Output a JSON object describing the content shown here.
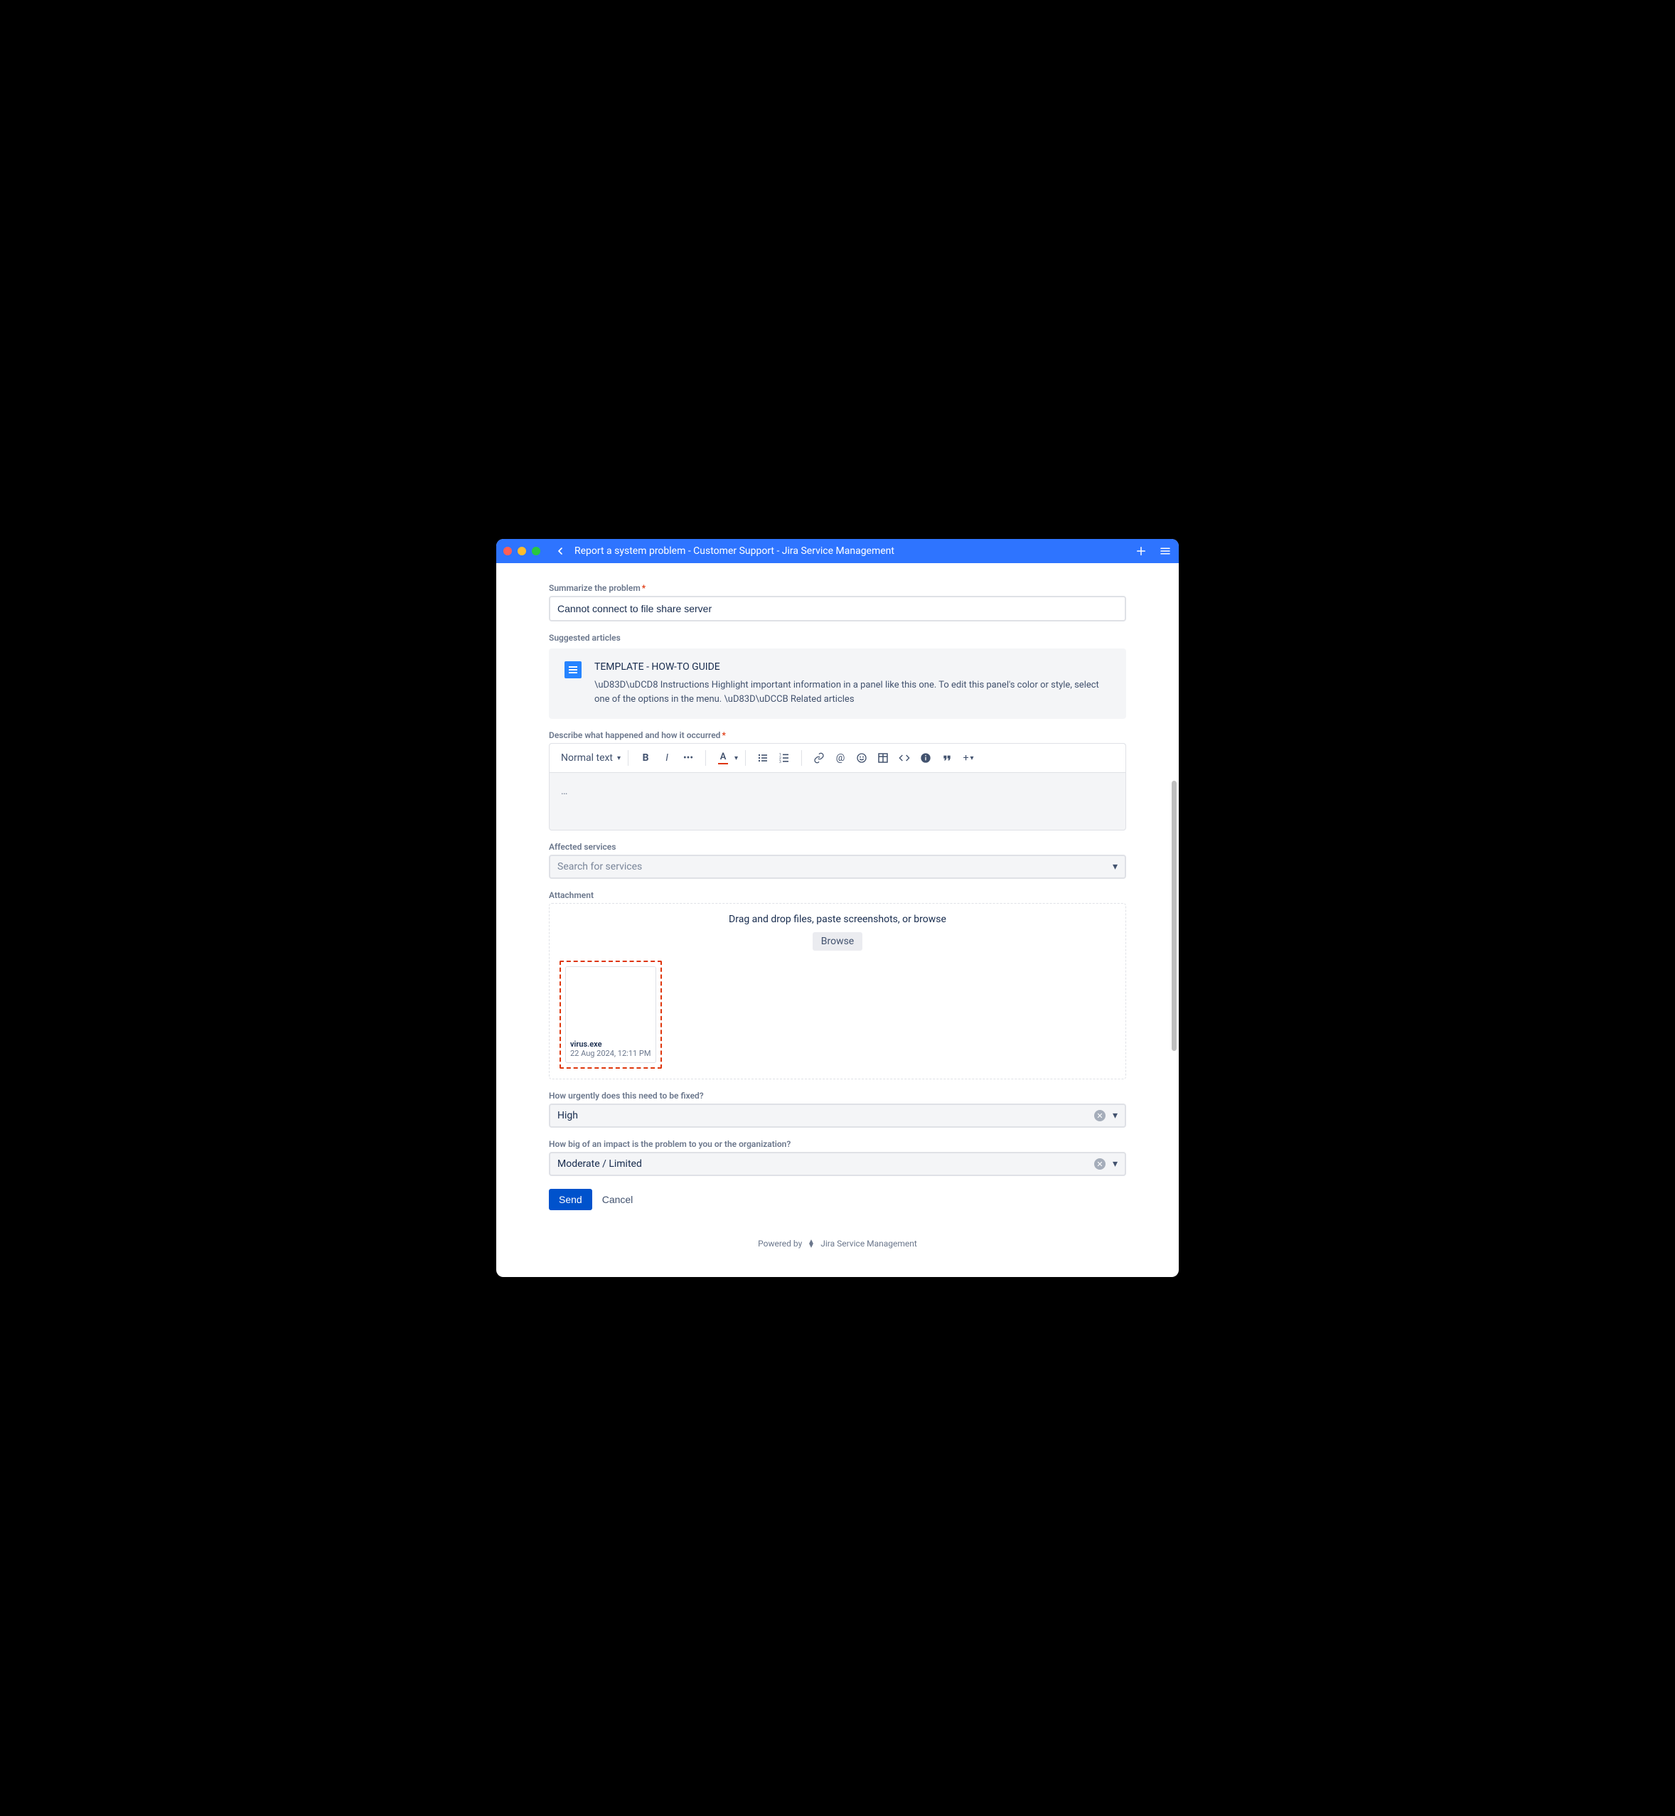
{
  "window": {
    "title": "Report a system problem - Customer Support - Jira Service Management"
  },
  "form": {
    "summary": {
      "label": "Summarize the problem",
      "value": "Cannot connect to file share server"
    },
    "suggested": {
      "label": "Suggested articles",
      "items": [
        {
          "title": "TEMPLATE - HOW-TO GUIDE",
          "desc": "\\uD83D\\uDCD8  Instructions Highlight important information in a panel like this one. To edit this panel's color or style, select one of the options in the menu. \\uD83D\\uDCCB  Related articles"
        }
      ]
    },
    "describe": {
      "label": "Describe what happened and how it occurred",
      "style_selector": "Normal text",
      "content": "…"
    },
    "affected_services": {
      "label": "Affected services",
      "placeholder": "Search for services"
    },
    "attachment": {
      "label": "Attachment",
      "drop_text": "Drag and drop files, paste screenshots, or browse",
      "browse_label": "Browse",
      "files": [
        {
          "name": "virus.exe",
          "date": "22 Aug 2024, 12:11 PM"
        }
      ]
    },
    "urgency": {
      "label": "How urgently does this need to be fixed?",
      "value": "High"
    },
    "impact": {
      "label": "How big of an impact is the problem to you or the organization?",
      "value": "Moderate / Limited"
    },
    "actions": {
      "send": "Send",
      "cancel": "Cancel"
    }
  },
  "footer": {
    "powered": "Powered by",
    "product": "Jira Service Management"
  }
}
